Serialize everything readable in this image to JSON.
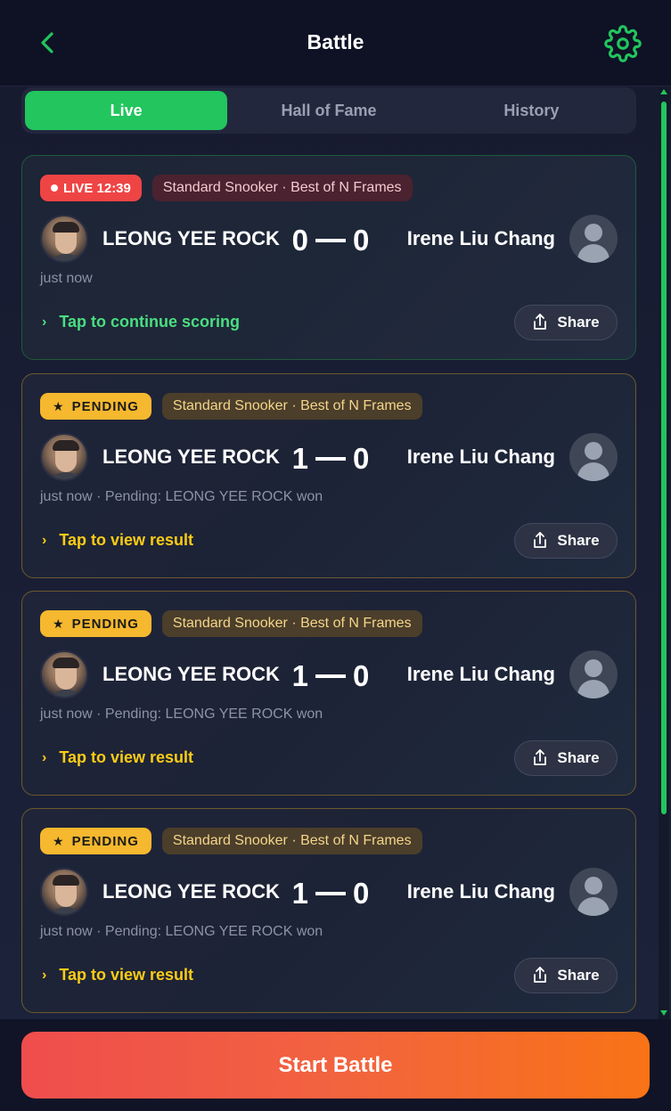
{
  "header": {
    "title": "Battle",
    "back_icon": "chevron-left-icon",
    "settings_icon": "gear-icon",
    "accent": "#22c55e"
  },
  "tabs": [
    {
      "label": "Live",
      "active": true
    },
    {
      "label": "Hall of Fame",
      "active": false
    },
    {
      "label": "History",
      "active": false
    }
  ],
  "battles": [
    {
      "status": "live",
      "status_label": "LIVE 12:39",
      "format": "Standard Snooker · Best of N Frames",
      "player_left": "LEONG YEE ROCK",
      "player_right": "Irene Liu Chang",
      "score_left": "0",
      "score_right": "0",
      "meta": "just now",
      "action": "Tap to continue scoring",
      "share": "Share"
    },
    {
      "status": "pending",
      "status_label": "PENDING",
      "format": "Standard Snooker · Best of N Frames",
      "player_left": "LEONG YEE ROCK",
      "player_right": "Irene Liu Chang",
      "score_left": "1",
      "score_right": "0",
      "meta": "just now · Pending: LEONG YEE ROCK won",
      "action": "Tap to view result",
      "share": "Share"
    },
    {
      "status": "pending",
      "status_label": "PENDING",
      "format": "Standard Snooker · Best of N Frames",
      "player_left": "LEONG YEE ROCK",
      "player_right": "Irene Liu Chang",
      "score_left": "1",
      "score_right": "0",
      "meta": "just now · Pending: LEONG YEE ROCK won",
      "action": "Tap to view result",
      "share": "Share"
    },
    {
      "status": "pending",
      "status_label": "PENDING",
      "format": "Standard Snooker · Best of N Frames",
      "player_left": "LEONG YEE ROCK",
      "player_right": "Irene Liu Chang",
      "score_left": "1",
      "score_right": "0",
      "meta": "just now · Pending: LEONG YEE ROCK won",
      "action": "Tap to view result",
      "share": "Share"
    }
  ],
  "footer": {
    "start_label": "Start Battle"
  },
  "colors": {
    "live": "#ef4444",
    "pending": "#f5b82e",
    "live_action": "#4ade80",
    "pending_action": "#facc15"
  }
}
